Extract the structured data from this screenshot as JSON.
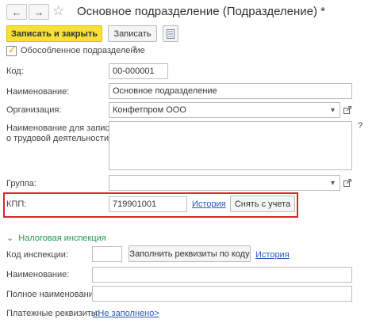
{
  "window": {
    "title": "Основное подразделение (Подразделение) *"
  },
  "icons": {
    "back": "arrow-left-icon",
    "forward": "arrow-right-icon",
    "favorite": "star-icon",
    "more": "list-menu-icon"
  },
  "toolbar": {
    "save_close_label": "Записать и закрыть",
    "save_label": "Записать"
  },
  "form": {
    "separate_unit_label": "Обособленное подразделение",
    "separate_unit_checked": true,
    "help_mark": "?",
    "code_label": "Код:",
    "code_value": "00-000001",
    "name_label": "Наименование:",
    "name_value": "Основное подразделение",
    "org_label": "Организация:",
    "org_value": "Конфетпром ООО",
    "labor_name_label_1": "Наименование для записей",
    "labor_name_label_2": "о трудовой деятельности:",
    "labor_name_value": "",
    "group_label": "Группа:",
    "group_value": "",
    "kpp_label": "КПП:",
    "kpp_value": "719901001",
    "kpp_history_link": "История",
    "kpp_deregister_button": "Снять с учета"
  },
  "tax": {
    "section_label": "Налоговая инспекция",
    "inspection_code_label": "Код инспекции:",
    "inspection_code_value": "",
    "fill_button": "Заполнить реквизиты по коду",
    "history_link": "История",
    "name_label": "Наименование:",
    "name_value": "",
    "full_name_label": "Полное наименование:",
    "full_name_value": "",
    "payment_label": "Платежные реквизиты:",
    "payment_link": "<Не заполнено>"
  },
  "colors": {
    "primary_button": "#f7e037",
    "highlight_border": "#d6282b",
    "section_green": "#1f9a4f",
    "link_blue": "#2b5ab3"
  }
}
